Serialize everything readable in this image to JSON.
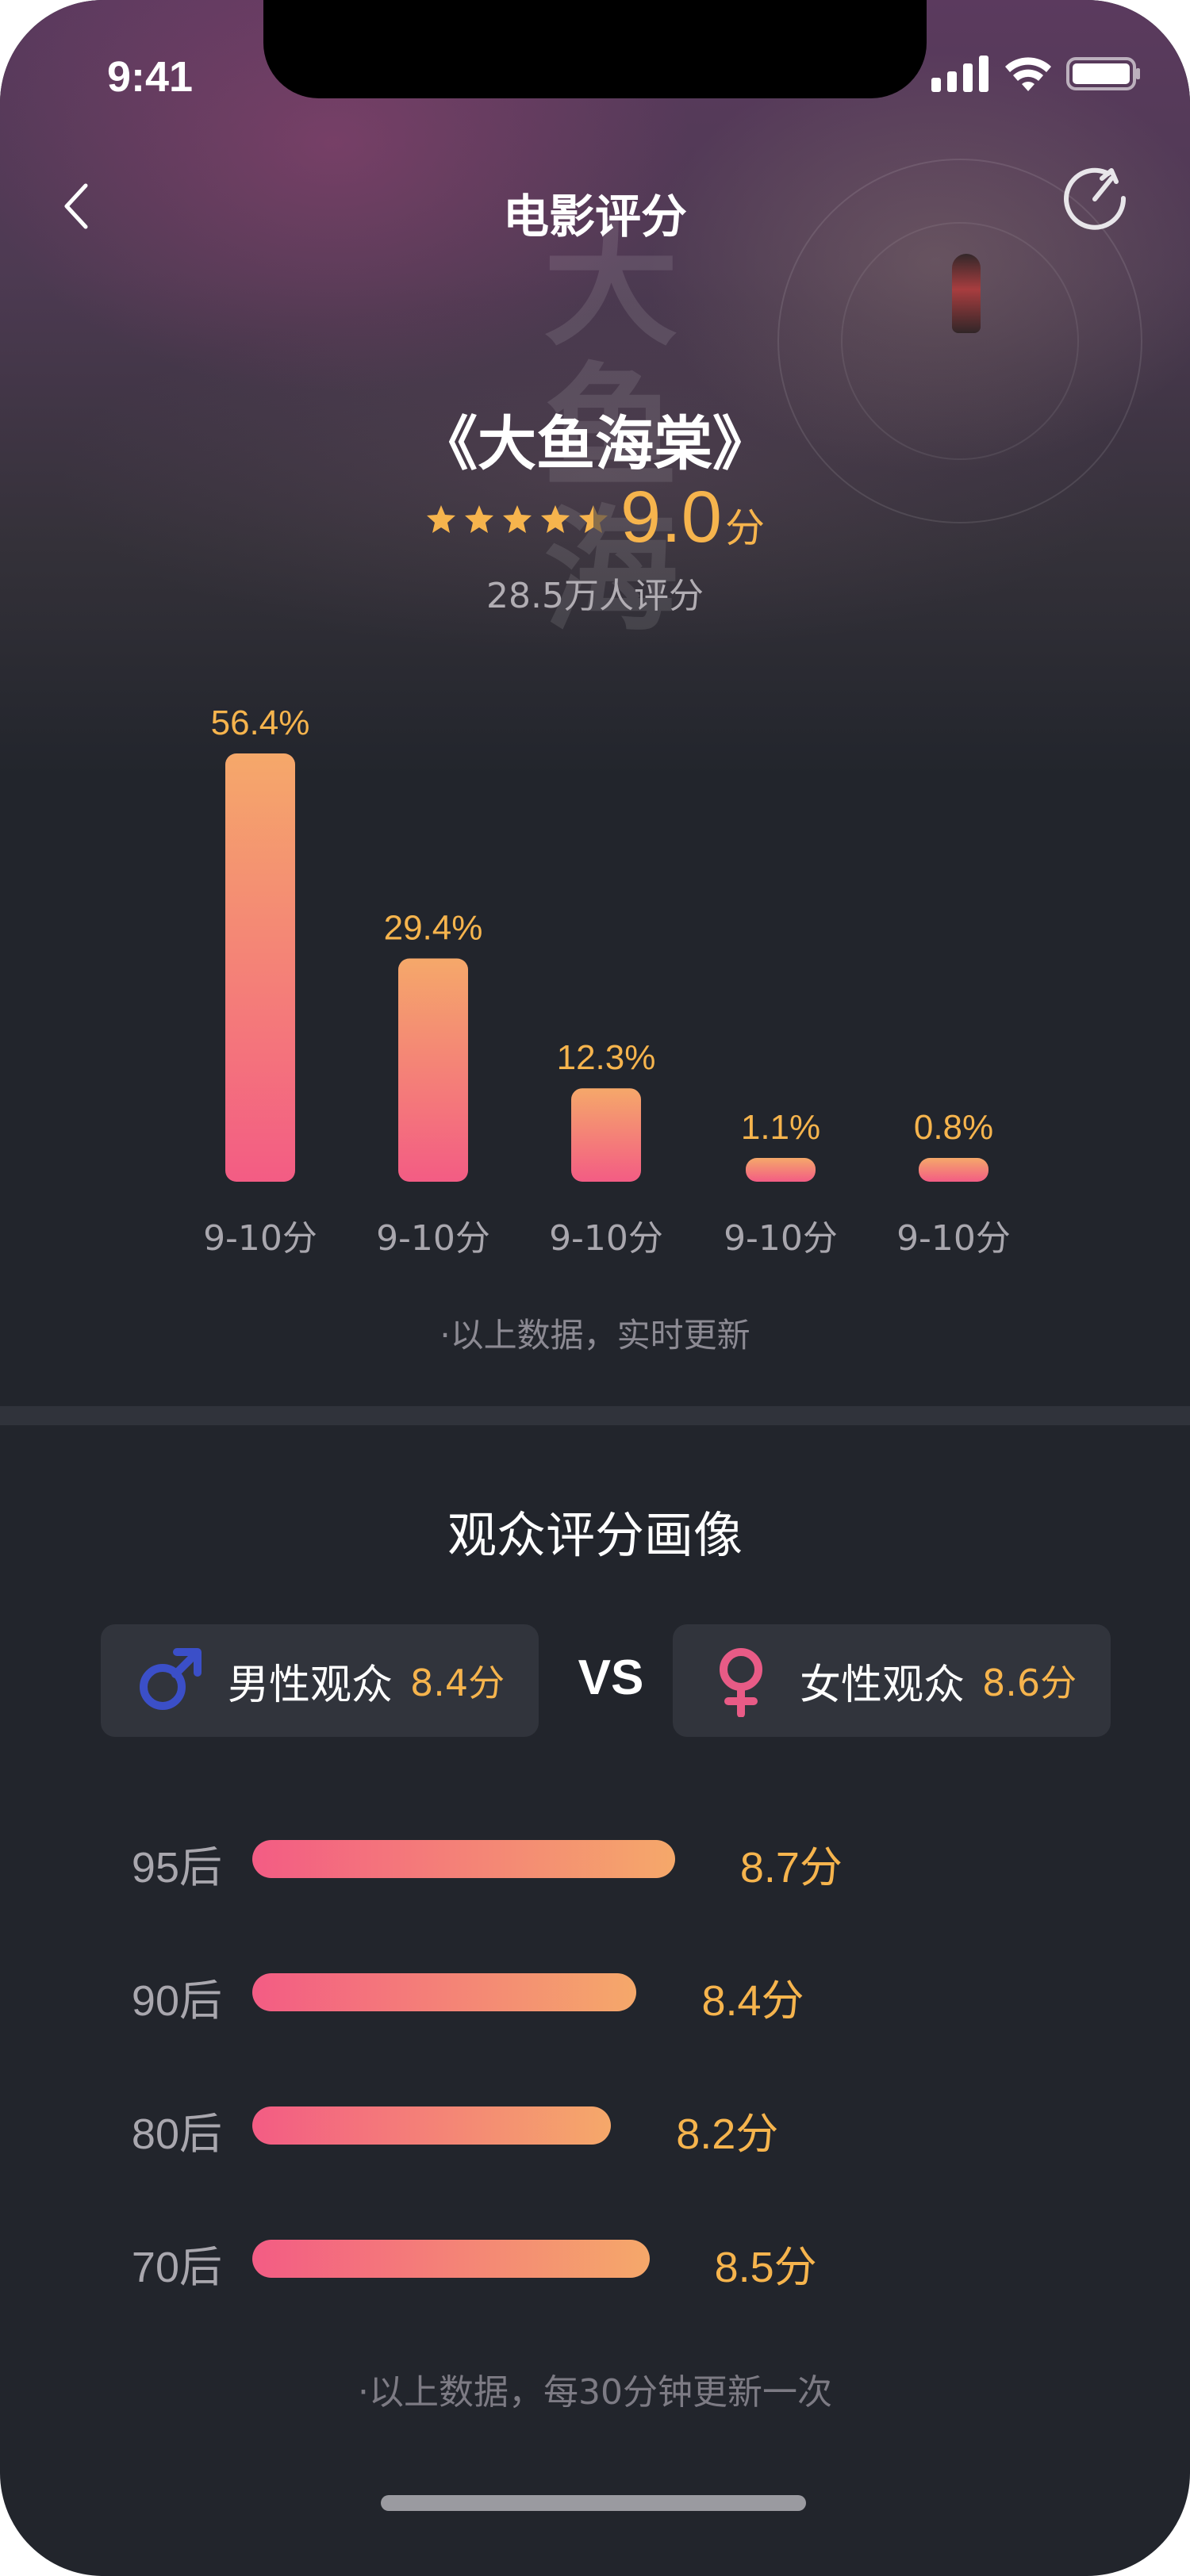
{
  "status_bar": {
    "time": "9:41"
  },
  "nav": {
    "title": "电影评分"
  },
  "movie": {
    "title": "《大鱼海棠》",
    "stars": 4.5,
    "score": "9.0",
    "score_unit": "分",
    "rating_count": "28.5万人评分"
  },
  "chart_data": {
    "type": "bar",
    "categories": [
      "9-10分",
      "9-10分",
      "9-10分",
      "9-10分",
      "9-10分"
    ],
    "values": [
      56.4,
      29.4,
      12.3,
      1.1,
      0.8
    ],
    "value_labels": [
      "56.4%",
      "29.4%",
      "12.3%",
      "1.1%",
      "0.8%"
    ],
    "unit": "%",
    "ylim": [
      0,
      56.4
    ],
    "grid": false,
    "colors": {
      "bar_top": "#f5a86a",
      "bar_bottom": "#f35c84",
      "label": "#f6b44d",
      "tick": "#a9a7ae"
    }
  },
  "chart_note": "·以上数据，实时更新",
  "audience": {
    "title": "观众评分画像",
    "male": {
      "label": "男性观众",
      "score": "8.4分",
      "icon": "male-symbol-icon",
      "color": "#3b4fc8"
    },
    "vs": "VS",
    "female": {
      "label": "女性观众",
      "score": "8.6分",
      "icon": "female-symbol-icon",
      "color": "#e85b86"
    },
    "age_groups": [
      {
        "label": "95后",
        "score": "8.7分",
        "value": 8.7
      },
      {
        "label": "90后",
        "score": "8.4分",
        "value": 8.4
      },
      {
        "label": "80后",
        "score": "8.2分",
        "value": 8.2
      },
      {
        "label": "70后",
        "score": "8.5分",
        "value": 8.5
      }
    ],
    "note": "·以上数据，每30分钟更新一次"
  }
}
